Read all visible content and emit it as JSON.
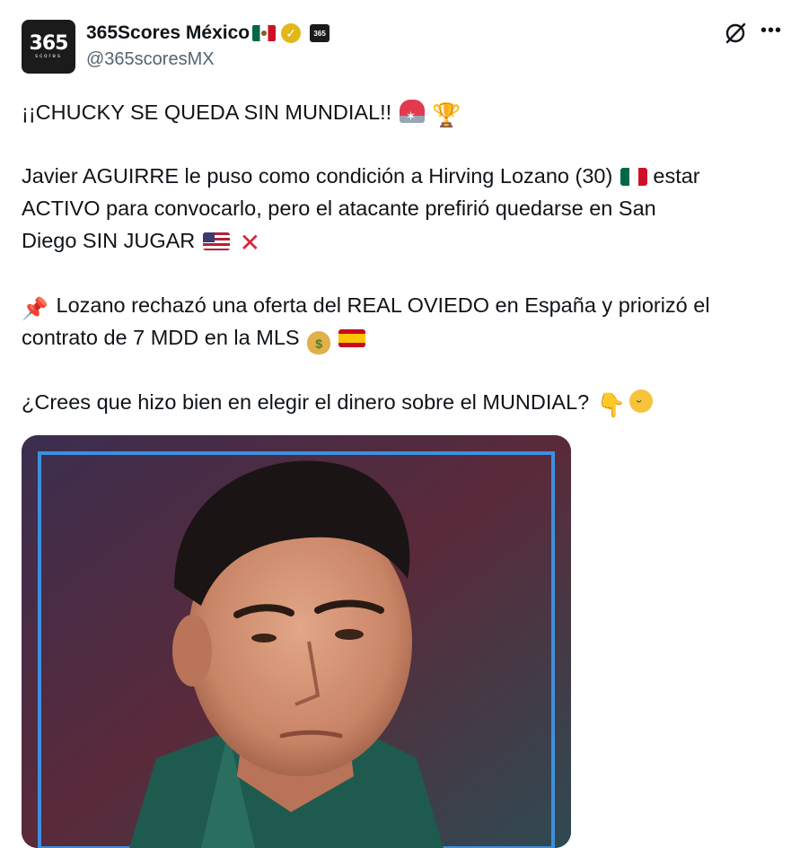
{
  "author": {
    "display_name": "365Scores México",
    "handle": "@365scoresMX",
    "avatar_text": "365",
    "avatar_subtext": "scores",
    "affiliate_badge_text": "365"
  },
  "tweet": {
    "line1": "¡¡CHUCKY SE QUEDA SIN MUNDIAL!!",
    "line2": "Javier AGUIRRE le puso como condición a Hirving Lozano (30)",
    "line2_end": "estar",
    "line3": "ACTIVO para convocarlo, pero el atacante prefirió quedarse en San",
    "line4": "Diego SIN JUGAR",
    "line5": "Lozano rechazó una oferta del REAL OVIEDO en España y priorizó el",
    "line6": "contrato de 7 MDD en la MLS",
    "line7": "¿Crees que hizo bien en elegir el dinero sobre el MUNDIAL?"
  },
  "icons": {
    "verified": "verified-badge-icon",
    "grok": "grok-icon",
    "more": "more-options-icon",
    "emojis": [
      "police-light",
      "trophy",
      "flag-mexico",
      "flag-usa",
      "cross-mark",
      "pushpin",
      "money-bag",
      "flag-spain",
      "backhand-index-down",
      "thinking-face"
    ]
  },
  "colors": {
    "text": "#0f1419",
    "secondary_text": "#536471",
    "verified_gold": "#e2b719",
    "image_frame": "#3d8fe0"
  }
}
